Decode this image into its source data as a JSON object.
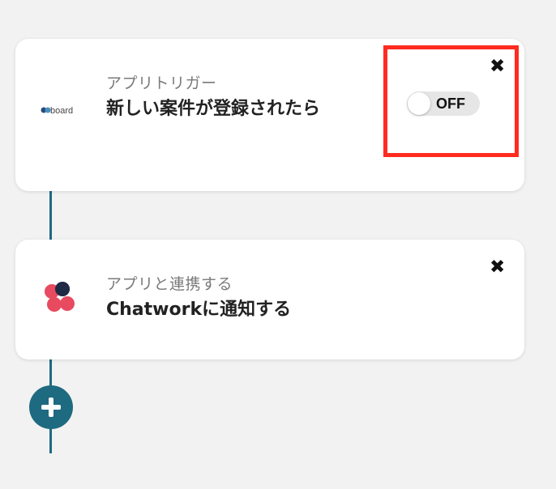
{
  "trigger_step": {
    "subtitle": "アプリトリガー",
    "title": "新しい案件が登録されたら",
    "app_icon": "board-logo",
    "toggle": {
      "state": "off",
      "label": "OFF"
    },
    "close_icon": "close-icon",
    "close_glyph": "✖"
  },
  "action_step": {
    "subtitle": "アプリと連携する",
    "title": "Chatworkに通知する",
    "app_icon": "chatwork-logo",
    "close_icon": "close-icon",
    "close_glyph": "✖"
  },
  "add_step": {
    "icon": "plus-icon"
  },
  "colors": {
    "background": "#f2f2f2",
    "connector": "#1e6a80",
    "highlight": "#ff2b1f",
    "toggle_track": "#e6e6e6",
    "chatwork_red": "#e84a5f",
    "chatwork_dark": "#1f2a44"
  }
}
